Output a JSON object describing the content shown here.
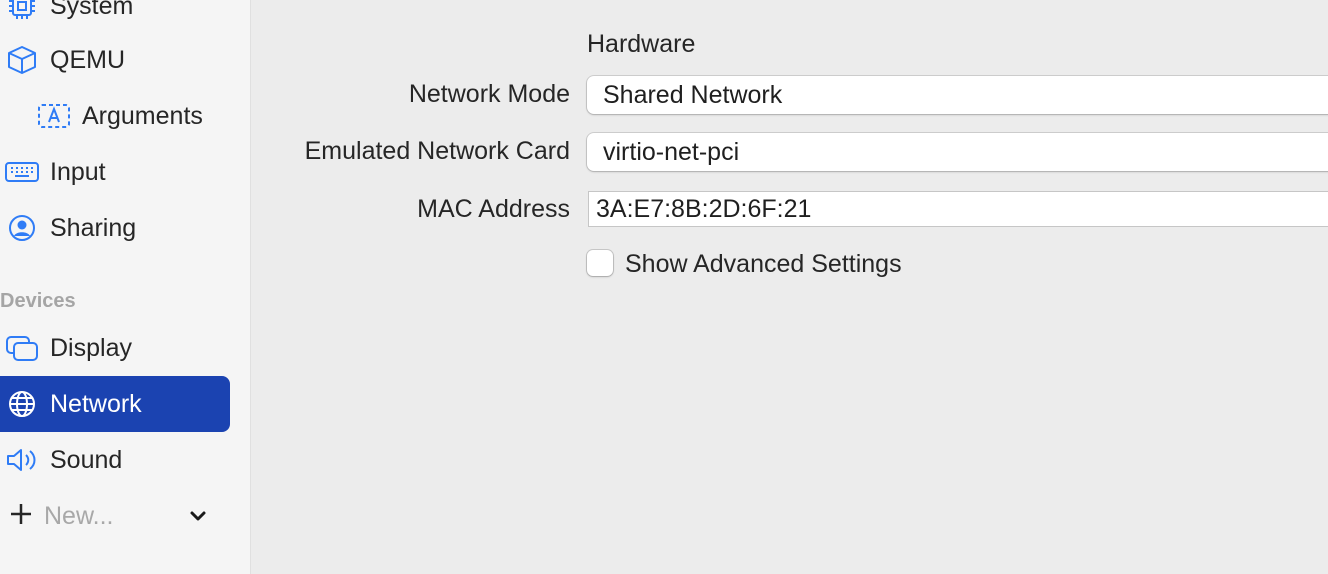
{
  "sidebar": {
    "items": [
      {
        "label": "System",
        "icon": "cpu-icon"
      },
      {
        "label": "QEMU",
        "icon": "cube-icon"
      },
      {
        "label": "Arguments",
        "icon": "text-box-icon"
      },
      {
        "label": "Input",
        "icon": "keyboard-icon"
      },
      {
        "label": "Sharing",
        "icon": "person-circle-icon"
      }
    ],
    "devices_header": "Devices",
    "devices": [
      {
        "label": "Display",
        "icon": "display-windows-icon"
      },
      {
        "label": "Network",
        "icon": "globe-icon",
        "selected": true
      },
      {
        "label": "Sound",
        "icon": "speaker-icon"
      }
    ],
    "new_label": "New..."
  },
  "main": {
    "section_title": "Hardware",
    "network_mode": {
      "label": "Network Mode",
      "value": "Shared Network"
    },
    "network_card": {
      "label": "Emulated Network Card",
      "value": "virtio-net-pci"
    },
    "mac_address": {
      "label": "MAC Address",
      "value": "3A:E7:8B:2D:6F:21"
    },
    "advanced": {
      "label": "Show Advanced Settings",
      "checked": false
    }
  },
  "colors": {
    "accent": "#1b43b1",
    "icon_blue": "#2f7cf6",
    "sidebar_bg": "#f5f5f5",
    "content_bg": "#ececec"
  }
}
